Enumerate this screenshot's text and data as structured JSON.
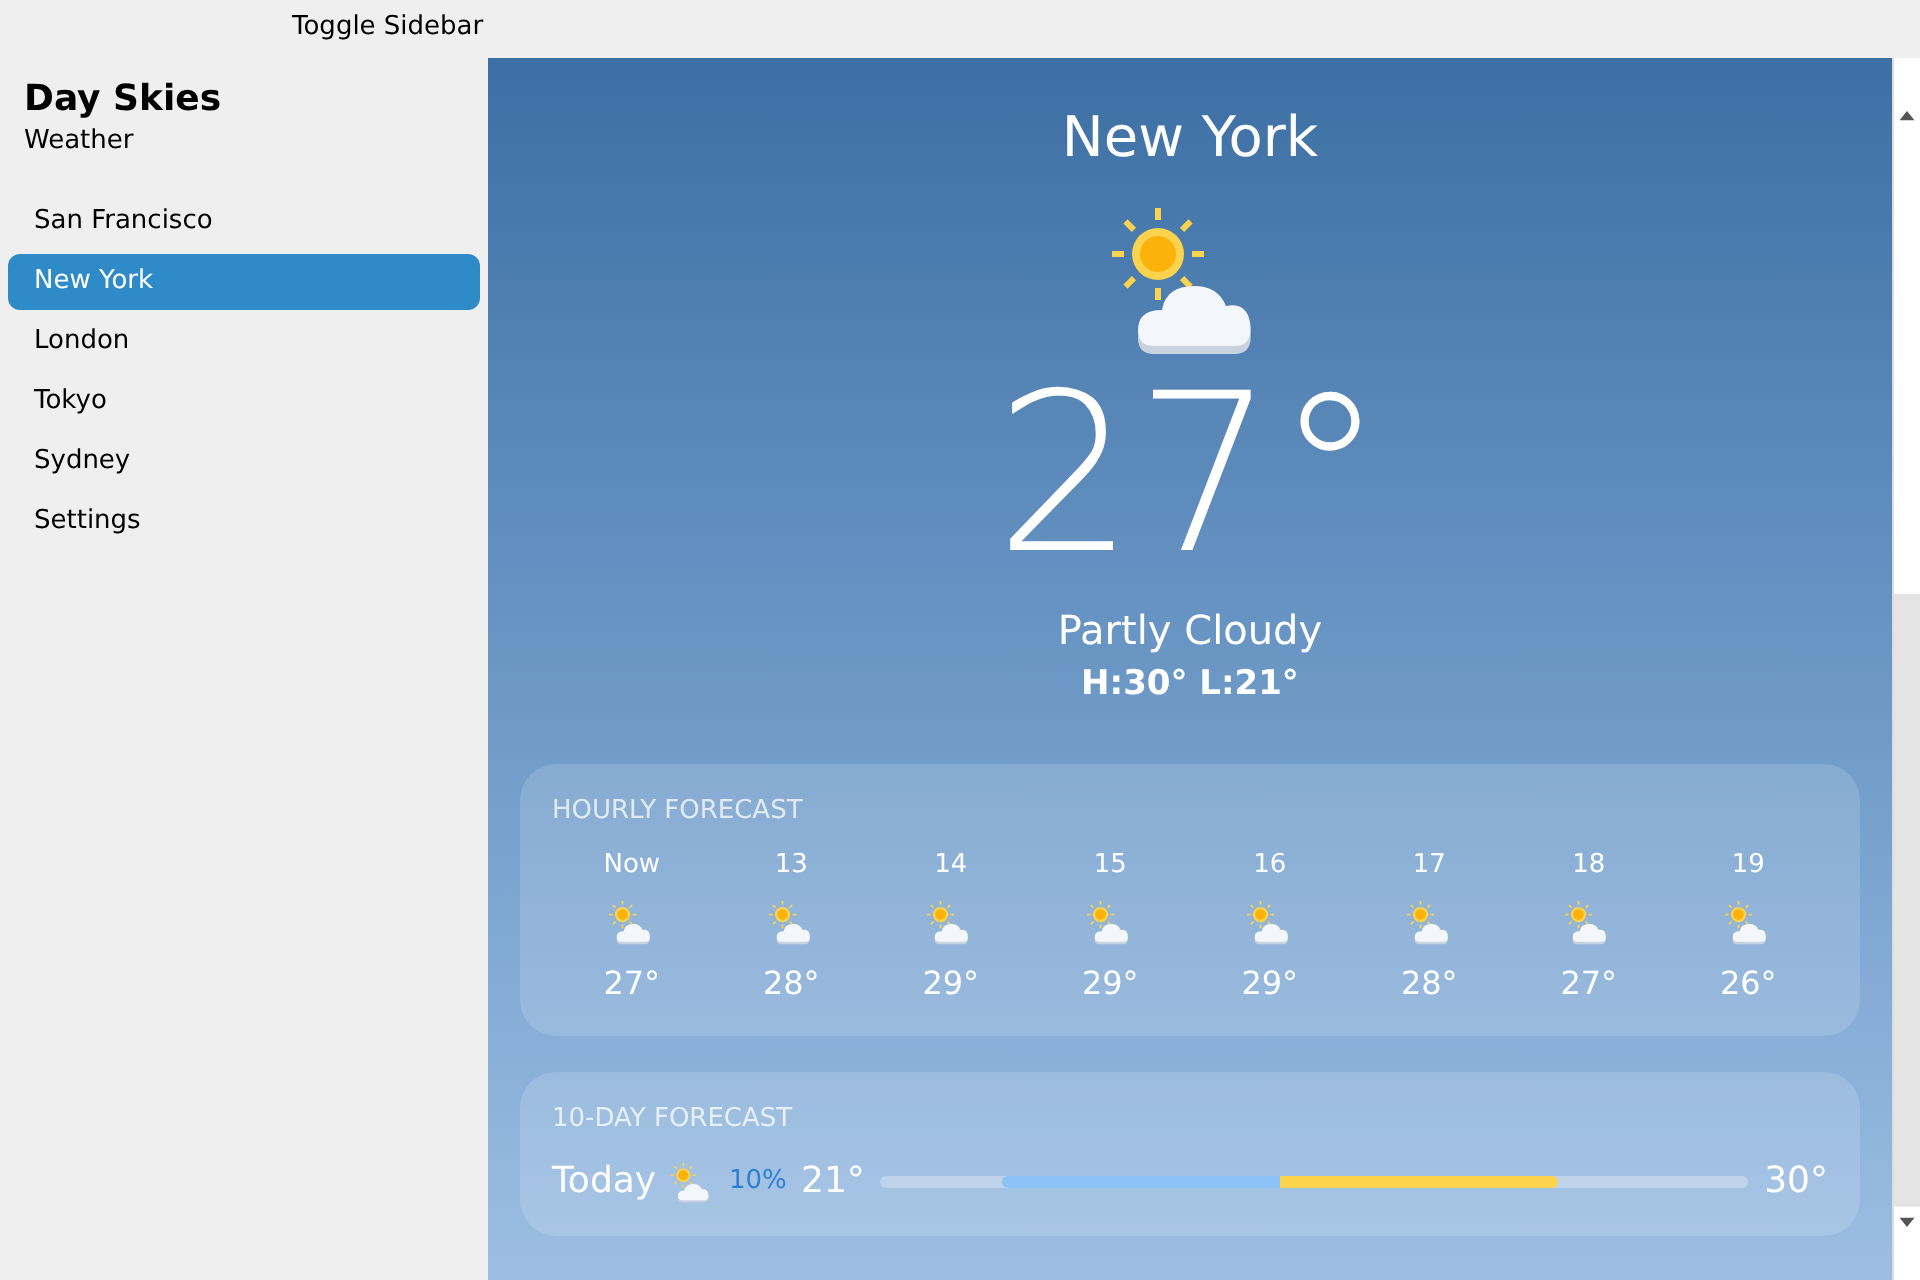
{
  "toolbar": {
    "toggle_label": "Toggle Sidebar"
  },
  "sidebar": {
    "title": "Day Skies",
    "subtitle": "Weather",
    "items": [
      {
        "label": "San Francisco",
        "selected": false
      },
      {
        "label": "New York",
        "selected": true
      },
      {
        "label": "London",
        "selected": false
      },
      {
        "label": "Tokyo",
        "selected": false
      },
      {
        "label": "Sydney",
        "selected": false
      },
      {
        "label": "Settings",
        "selected": false
      }
    ]
  },
  "current": {
    "city": "New York",
    "temperature": "27°",
    "condition": "Partly Cloudy",
    "high_low": "H:30° L:21°"
  },
  "hourly": {
    "title": "HOURLY FORECAST",
    "hours": [
      {
        "time": "Now",
        "temp": "27°"
      },
      {
        "time": "13",
        "temp": "28°"
      },
      {
        "time": "14",
        "temp": "29°"
      },
      {
        "time": "15",
        "temp": "29°"
      },
      {
        "time": "16",
        "temp": "29°"
      },
      {
        "time": "17",
        "temp": "28°"
      },
      {
        "time": "18",
        "temp": "27°"
      },
      {
        "time": "19",
        "temp": "26°"
      }
    ]
  },
  "daily": {
    "title": "10-DAY FORECAST",
    "days": [
      {
        "day": "Today",
        "precip": "10%",
        "low": "21°",
        "high": "30°"
      }
    ]
  }
}
